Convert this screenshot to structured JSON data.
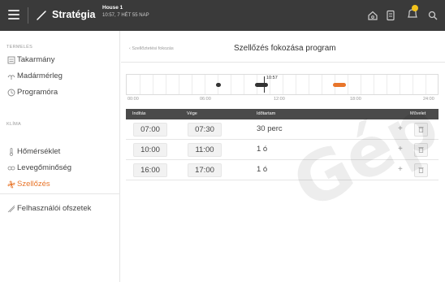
{
  "topbar": {
    "title": "Stratégia",
    "house": "House 1",
    "time": "10:57, 7 HÉT 55 NAP"
  },
  "sidebar": {
    "section_termeles": "TERMELÉS",
    "section_klima": "KLÍMA",
    "items": [
      {
        "label": "Takarmány",
        "icon": "feed-icon"
      },
      {
        "label": "Madármérleg",
        "icon": "bird-scale-icon"
      },
      {
        "label": "Programóra",
        "icon": "clock-icon"
      },
      {
        "label": "Hőmérséklet",
        "icon": "thermometer-icon"
      },
      {
        "label": "Levegőminőség",
        "icon": "co2-icon"
      },
      {
        "label": "Szellőzés",
        "icon": "fan-icon"
      },
      {
        "label": "Felhasználói ofszetek",
        "icon": "user-offset-icon"
      }
    ],
    "active_color": "#e8752a"
  },
  "main": {
    "breadcrumb": "‹ Szellőztetési fokozás",
    "title": "Szellőzés fokozása program",
    "timeline": {
      "labels": [
        "00:00",
        "06:00",
        "12:00",
        "18:00",
        "24:00"
      ],
      "now_label": "10:57"
    },
    "table": {
      "headers": {
        "start": "Indítás",
        "end": "Vége",
        "duration": "Időtartam",
        "action": "Művelet"
      },
      "rows": [
        {
          "start": "07:00",
          "end": "07:30",
          "duration": "30 perc"
        },
        {
          "start": "10:00",
          "end": "11:00",
          "duration": "1 ó"
        },
        {
          "start": "16:00",
          "end": "17:00",
          "duration": "1 ó"
        }
      ]
    }
  },
  "watermark": "Gép"
}
